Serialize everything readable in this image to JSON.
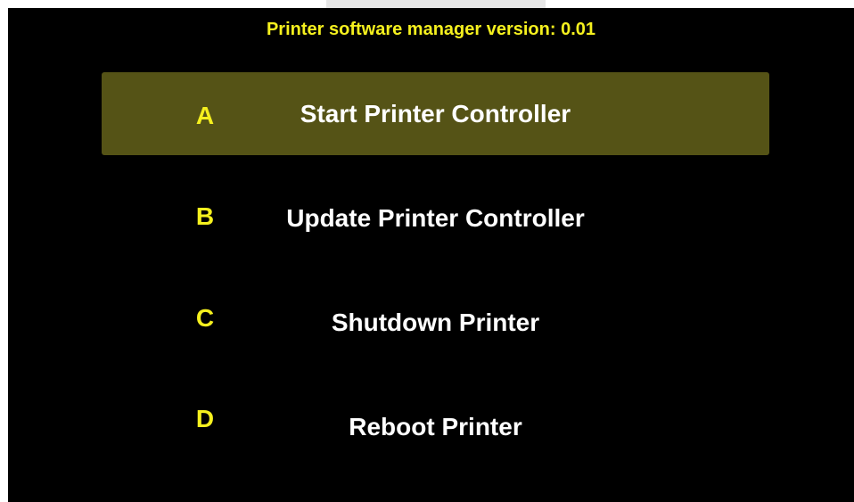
{
  "header": {
    "title": "Printer software manager version: 0.01"
  },
  "menu": {
    "items": [
      {
        "key": "A",
        "label": "Start Printer Controller",
        "selected": true
      },
      {
        "key": "B",
        "label": "Update Printer Controller",
        "selected": false
      },
      {
        "key": "C",
        "label": "Shutdown Printer",
        "selected": false
      },
      {
        "key": "D",
        "label": "Reboot Printer",
        "selected": false
      }
    ]
  },
  "colors": {
    "background": "#000000",
    "title": "#f5f01e",
    "key": "#f5f01e",
    "label": "#ffffff",
    "selected_highlight": "#555316"
  }
}
